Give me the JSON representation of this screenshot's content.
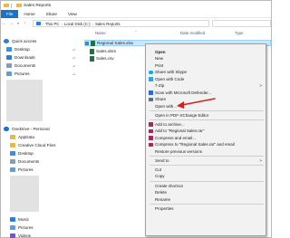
{
  "window": {
    "title": "Sales Reports"
  },
  "ribbon": {
    "tabs": [
      "File",
      "Home",
      "Share",
      "View"
    ]
  },
  "address": {
    "breadcrumb": [
      "This PC",
      "Local Disk (C:)",
      "Sales Reports"
    ]
  },
  "nav": {
    "quick_access": "Quick access",
    "items": [
      {
        "label": "Desktop",
        "icon": "desktop-icon",
        "pinned": true
      },
      {
        "label": "Downloads",
        "icon": "download-icon",
        "pinned": true
      },
      {
        "label": "Documents",
        "icon": "documents-icon",
        "pinned": true
      },
      {
        "label": "Pictures",
        "icon": "pictures-icon",
        "pinned": true
      }
    ],
    "onedrive": "OneDrive - Personal",
    "onedrive_items": [
      "AppData",
      "Creative Cloud Files",
      "Desktop",
      "Documents",
      "Pictures"
    ],
    "lower_items": [
      "Music",
      "Pictures",
      "Videos"
    ]
  },
  "content": {
    "columns": [
      "Name",
      "Date modified",
      "Type"
    ],
    "files": [
      {
        "name": "Regional Sales.xlsx",
        "selected": true
      },
      {
        "name": "Sales.xlsm",
        "selected": false
      },
      {
        "name": "Sales.csv",
        "selected": false
      }
    ]
  },
  "context_menu": {
    "items": [
      {
        "label": "Open",
        "bold": true,
        "icon": "",
        "submenu": false
      },
      {
        "label": "New",
        "icon": "",
        "submenu": false
      },
      {
        "label": "Print",
        "icon": "",
        "submenu": false
      },
      {
        "label": "Share with Skype",
        "icon": "skype-icon",
        "submenu": false
      },
      {
        "label": "Open with Code",
        "icon": "vscode-icon",
        "submenu": false
      },
      {
        "label": "7-Zip",
        "icon": "",
        "submenu": true
      },
      {
        "label": "Scan with Microsoft Defender...",
        "icon": "defender-icon",
        "submenu": false
      },
      {
        "label": "Share",
        "icon": "share-icon",
        "submenu": false
      },
      {
        "label": "Open with...",
        "icon": "",
        "submenu": false
      },
      {
        "label": "Open in PDF-XChange Editor",
        "icon": "",
        "submenu": false
      },
      {
        "label": "Add to archive...",
        "icon": "winrar-icon",
        "submenu": false
      },
      {
        "label": "Add to \"Regional Sales.rar\"",
        "icon": "winrar-icon",
        "submenu": false
      },
      {
        "label": "Compress and email...",
        "icon": "winrar-icon",
        "submenu": false
      },
      {
        "label": "Compress to \"Regional Sales.rar\" and email",
        "icon": "winrar-icon",
        "submenu": false
      },
      {
        "label": "Restore previous versions",
        "icon": "",
        "submenu": false
      },
      {
        "label": "Send to",
        "icon": "",
        "submenu": true
      },
      {
        "label": "Cut",
        "icon": "",
        "submenu": false
      },
      {
        "label": "Copy",
        "icon": "",
        "submenu": false
      },
      {
        "label": "Create shortcut",
        "icon": "",
        "submenu": false
      },
      {
        "label": "Delete",
        "icon": "",
        "submenu": false
      },
      {
        "label": "Rename",
        "icon": "",
        "submenu": false
      },
      {
        "label": "Properties",
        "icon": "",
        "submenu": false
      }
    ],
    "submenu_glyph": ">"
  },
  "colors": {
    "accent": "#1a73c8",
    "selection": "#cce8ff",
    "arrow": "#d42020",
    "excel": "#1f7244"
  }
}
